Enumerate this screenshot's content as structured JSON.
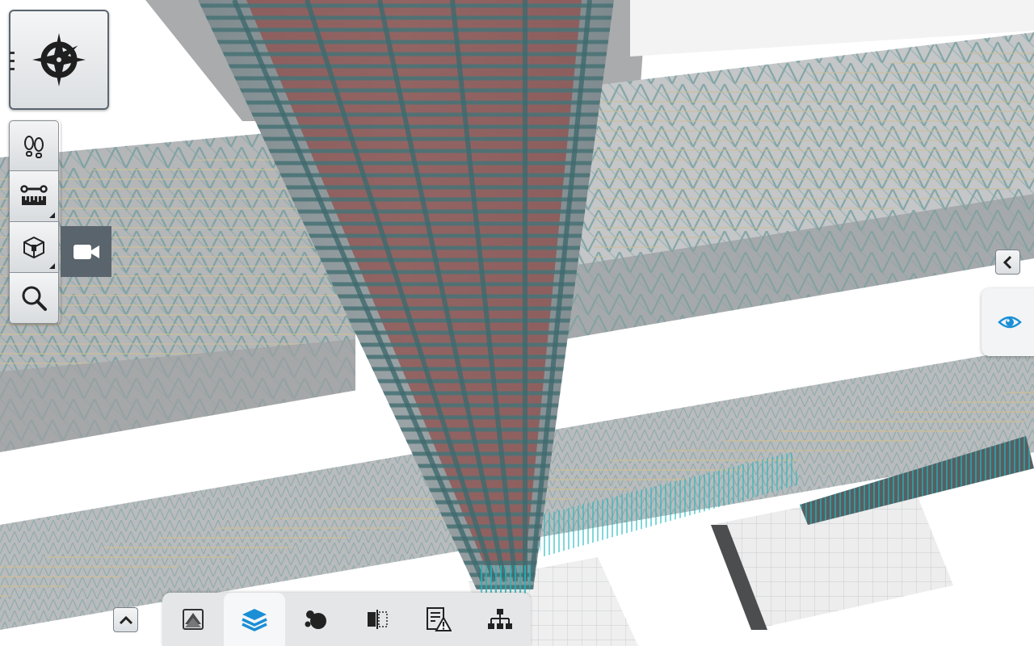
{
  "app": {
    "accent_color": "#1a8fd6",
    "panel_color": "#e4e6e8",
    "active_flyout_color": "#5a646c"
  },
  "navigation": {
    "cube_icon": "compass-rose-icon"
  },
  "left_toolbar": {
    "items": [
      {
        "id": "walk",
        "icon": "footprints-icon",
        "has_submenu": false
      },
      {
        "id": "measure",
        "icon": "ruler-icon",
        "has_submenu": true
      },
      {
        "id": "section",
        "icon": "section-box-icon",
        "has_submenu": true
      },
      {
        "id": "zoom",
        "icon": "magnifier-icon",
        "has_submenu": false
      }
    ],
    "flyout": {
      "icon": "camera-icon"
    }
  },
  "right_panel": {
    "collapse_icon": "chevron-left-icon",
    "visibility_icon": "eye-icon"
  },
  "bottom_toolbar": {
    "expand_icon": "chevron-up-icon",
    "tabs": [
      {
        "id": "views",
        "icon": "views-icon",
        "active": false
      },
      {
        "id": "layers",
        "icon": "layers-icon",
        "active": true
      },
      {
        "id": "objects",
        "icon": "objects-icon",
        "active": false
      },
      {
        "id": "compare",
        "icon": "compare-icon",
        "active": false
      },
      {
        "id": "issues",
        "icon": "issues-icon",
        "active": false
      },
      {
        "id": "hierarchy",
        "icon": "hierarchy-icon",
        "active": false
      }
    ]
  }
}
